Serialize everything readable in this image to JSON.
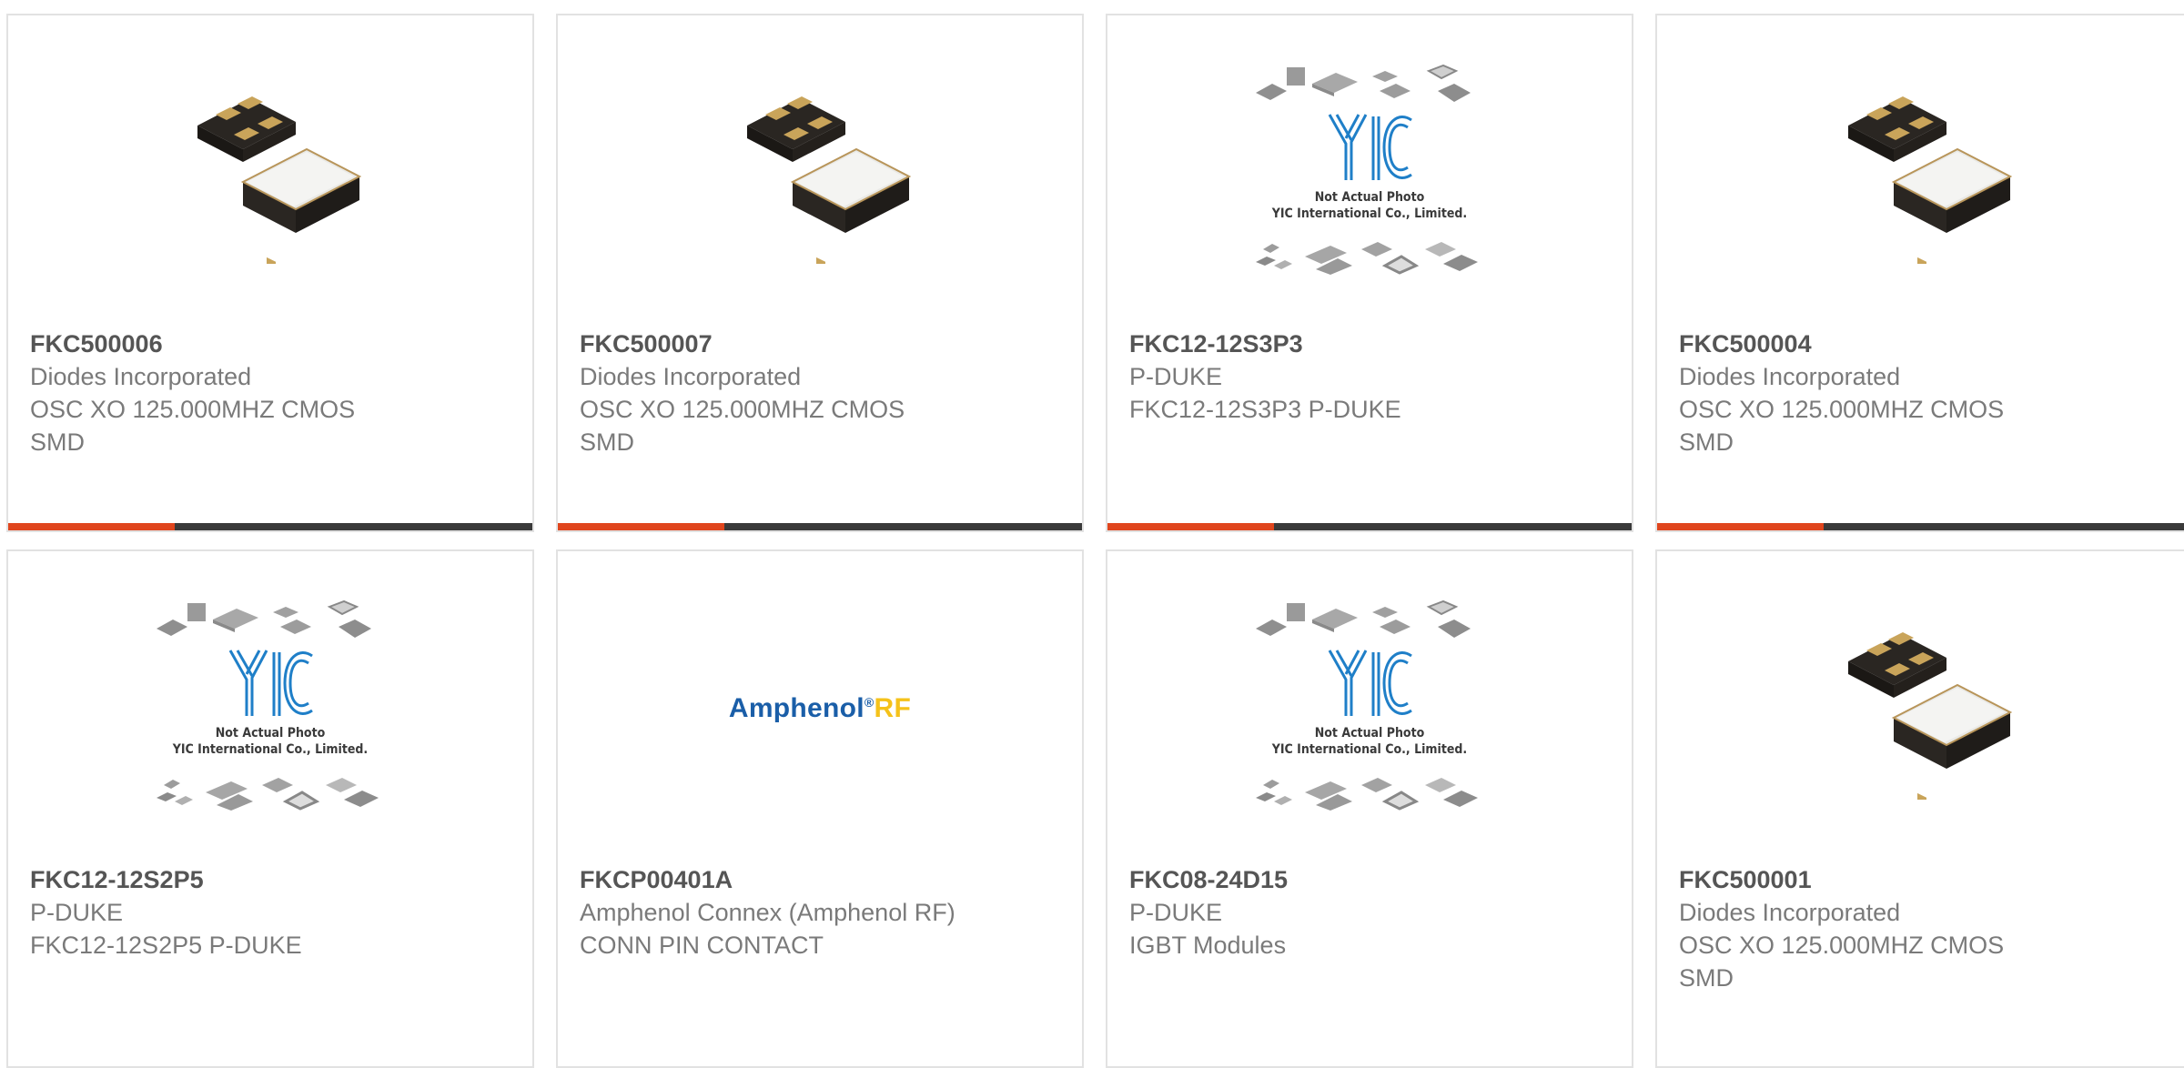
{
  "products": [
    {
      "part": "FKC500006",
      "manufacturer": "Diodes Incorporated",
      "description": "OSC XO 125.000MHZ CMOS SMD",
      "image": "crystal-oscillator",
      "show_bar": true
    },
    {
      "part": "FKC500007",
      "manufacturer": "Diodes Incorporated",
      "description": "OSC XO 125.000MHZ CMOS SMD",
      "image": "crystal-oscillator",
      "show_bar": true
    },
    {
      "part": "FKC12-12S3P3",
      "manufacturer": "P-DUKE",
      "description": "FKC12-12S3P3 P-DUKE",
      "image": "yic-placeholder",
      "show_bar": true
    },
    {
      "part": "FKC500004",
      "manufacturer": "Diodes Incorporated",
      "description": "OSC XO 125.000MHZ CMOS SMD",
      "image": "crystal-oscillator",
      "show_bar": true
    },
    {
      "part": "FKC12-12S2P5",
      "manufacturer": "P-DUKE",
      "description": "FKC12-12S2P5 P-DUKE",
      "image": "yic-placeholder",
      "show_bar": false
    },
    {
      "part": "FKCP00401A",
      "manufacturer": "Amphenol Connex (Amphenol RF)",
      "description": "CONN PIN CONTACT",
      "image": "amphenol-logo",
      "show_bar": false
    },
    {
      "part": "FKC08-24D15",
      "manufacturer": "P-DUKE",
      "description": "IGBT Modules",
      "image": "yic-placeholder",
      "show_bar": false
    },
    {
      "part": "FKC500001",
      "manufacturer": "Diodes Incorporated",
      "description": "OSC XO 125.000MHZ CMOS SMD",
      "image": "crystal-oscillator",
      "show_bar": false
    }
  ],
  "yic_placeholder": {
    "line1": "Not Actual Photo",
    "line2": "YIC International Co., Limited.",
    "logo_text": "YIC"
  },
  "amphenol_logo": {
    "name": "Amphenol",
    "suffix": "RF"
  },
  "colors": {
    "accent": "#e0451d",
    "bar_dark": "#3a3a3a",
    "border": "#e2e2e2",
    "text": "#7a7a7a",
    "part_number": "#555555",
    "yic_blue": "#1f7fc8"
  }
}
